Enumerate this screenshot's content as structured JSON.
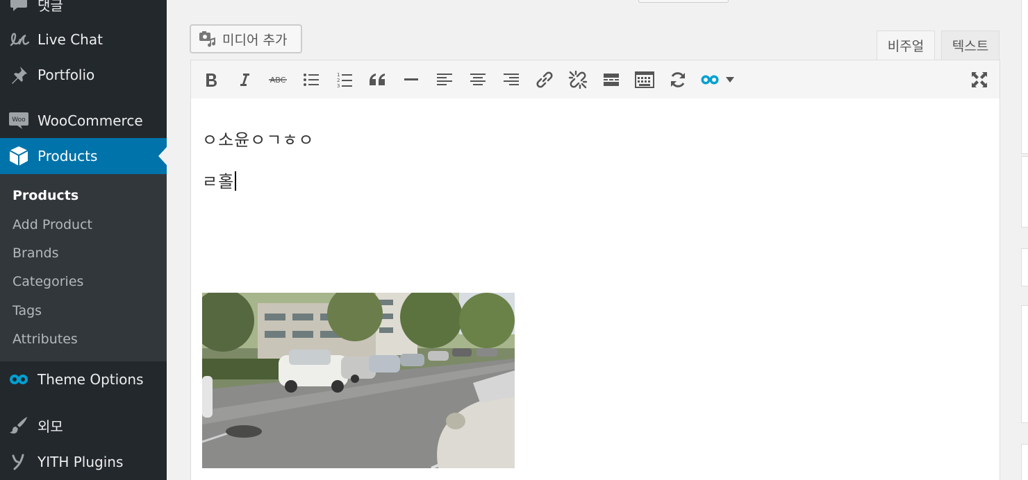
{
  "sidebar": {
    "items": [
      {
        "label": "댓글",
        "icon": "comment-icon"
      },
      {
        "label": "Live Chat",
        "icon": "live-chat-icon"
      },
      {
        "label": "Portfolio",
        "icon": "pin-icon"
      },
      {
        "label": "WooCommerce",
        "icon": "woo-icon"
      },
      {
        "label": "Products",
        "icon": "box-icon"
      },
      {
        "label": "Theme Options",
        "icon": "infinity-icon"
      },
      {
        "label": "외모",
        "icon": "brush-icon"
      },
      {
        "label": "YITH Plugins",
        "icon": "yith-icon"
      }
    ],
    "submenu": [
      {
        "label": "Products"
      },
      {
        "label": "Add Product"
      },
      {
        "label": "Brands"
      },
      {
        "label": "Categories"
      },
      {
        "label": "Tags"
      },
      {
        "label": "Attributes"
      }
    ],
    "woo_badge": "Woo"
  },
  "editor": {
    "add_media_label": "미디어 추가",
    "tab_visual": "비주얼",
    "tab_text": "텍스트",
    "content": {
      "line1": "ㅇ소윤ㅇㄱㅎㅇ",
      "line2": "ㄹ홀"
    },
    "toolbar": [
      "bold-icon",
      "italic-icon",
      "strikethrough-icon",
      "bullet-list-icon",
      "numbered-list-icon",
      "blockquote-icon",
      "horizontal-rule-icon",
      "align-left-icon",
      "align-center-icon",
      "align-right-icon",
      "link-icon",
      "unlink-icon",
      "read-more-icon",
      "keyboard-icon",
      "refresh-icon",
      "theme-options-icon",
      "fullscreen-icon"
    ],
    "strike_glyph": "ABC",
    "numbers_glyph": [
      "1",
      "2",
      "3"
    ]
  },
  "colors": {
    "sidebar_bg": "#23282d",
    "submenu_bg": "#32373c",
    "active_bg": "#0073aa",
    "accent_icon": "#00a0d2"
  }
}
